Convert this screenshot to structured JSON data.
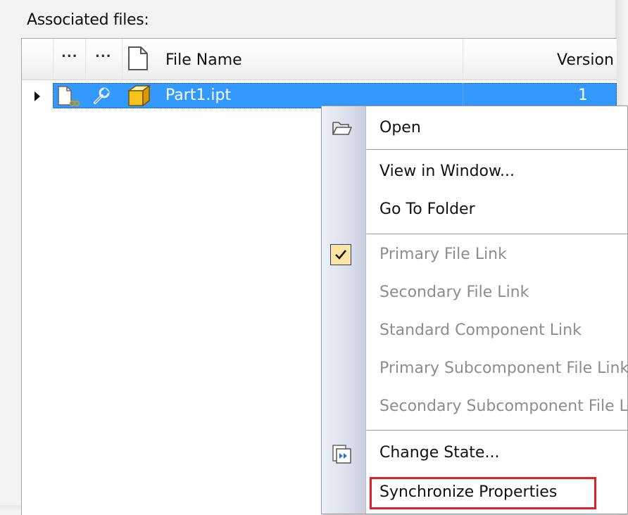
{
  "associated_label": "Associated files:",
  "grid": {
    "header": {
      "col1": "...",
      "col2": "...",
      "file_name": "File Name",
      "version": "Version"
    },
    "rows": [
      {
        "name": "Part1.ipt",
        "version": "1",
        "selected": true
      }
    ]
  },
  "context_menu": {
    "items": [
      {
        "label": "Open",
        "icon": "open-folder-icon",
        "enabled": true
      },
      {
        "label": "View in Window...",
        "enabled": true
      },
      {
        "label": "Go To Folder",
        "enabled": true
      },
      {
        "label": "Primary File Link",
        "enabled": false,
        "checked": true
      },
      {
        "label": "Secondary File Link",
        "enabled": false
      },
      {
        "label": "Standard Component Link",
        "enabled": false
      },
      {
        "label": "Primary Subcomponent File Link",
        "enabled": false
      },
      {
        "label": "Secondary Subcomponent File Link",
        "enabled": false
      },
      {
        "label": "Change State...",
        "icon": "change-state-icon",
        "enabled": true
      },
      {
        "label": "Synchronize Properties",
        "enabled": true,
        "highlighted": true
      }
    ]
  },
  "colors": {
    "selection": "#3399ff",
    "highlight_border": "#e0202b",
    "disabled_text": "#8d8d8d"
  }
}
